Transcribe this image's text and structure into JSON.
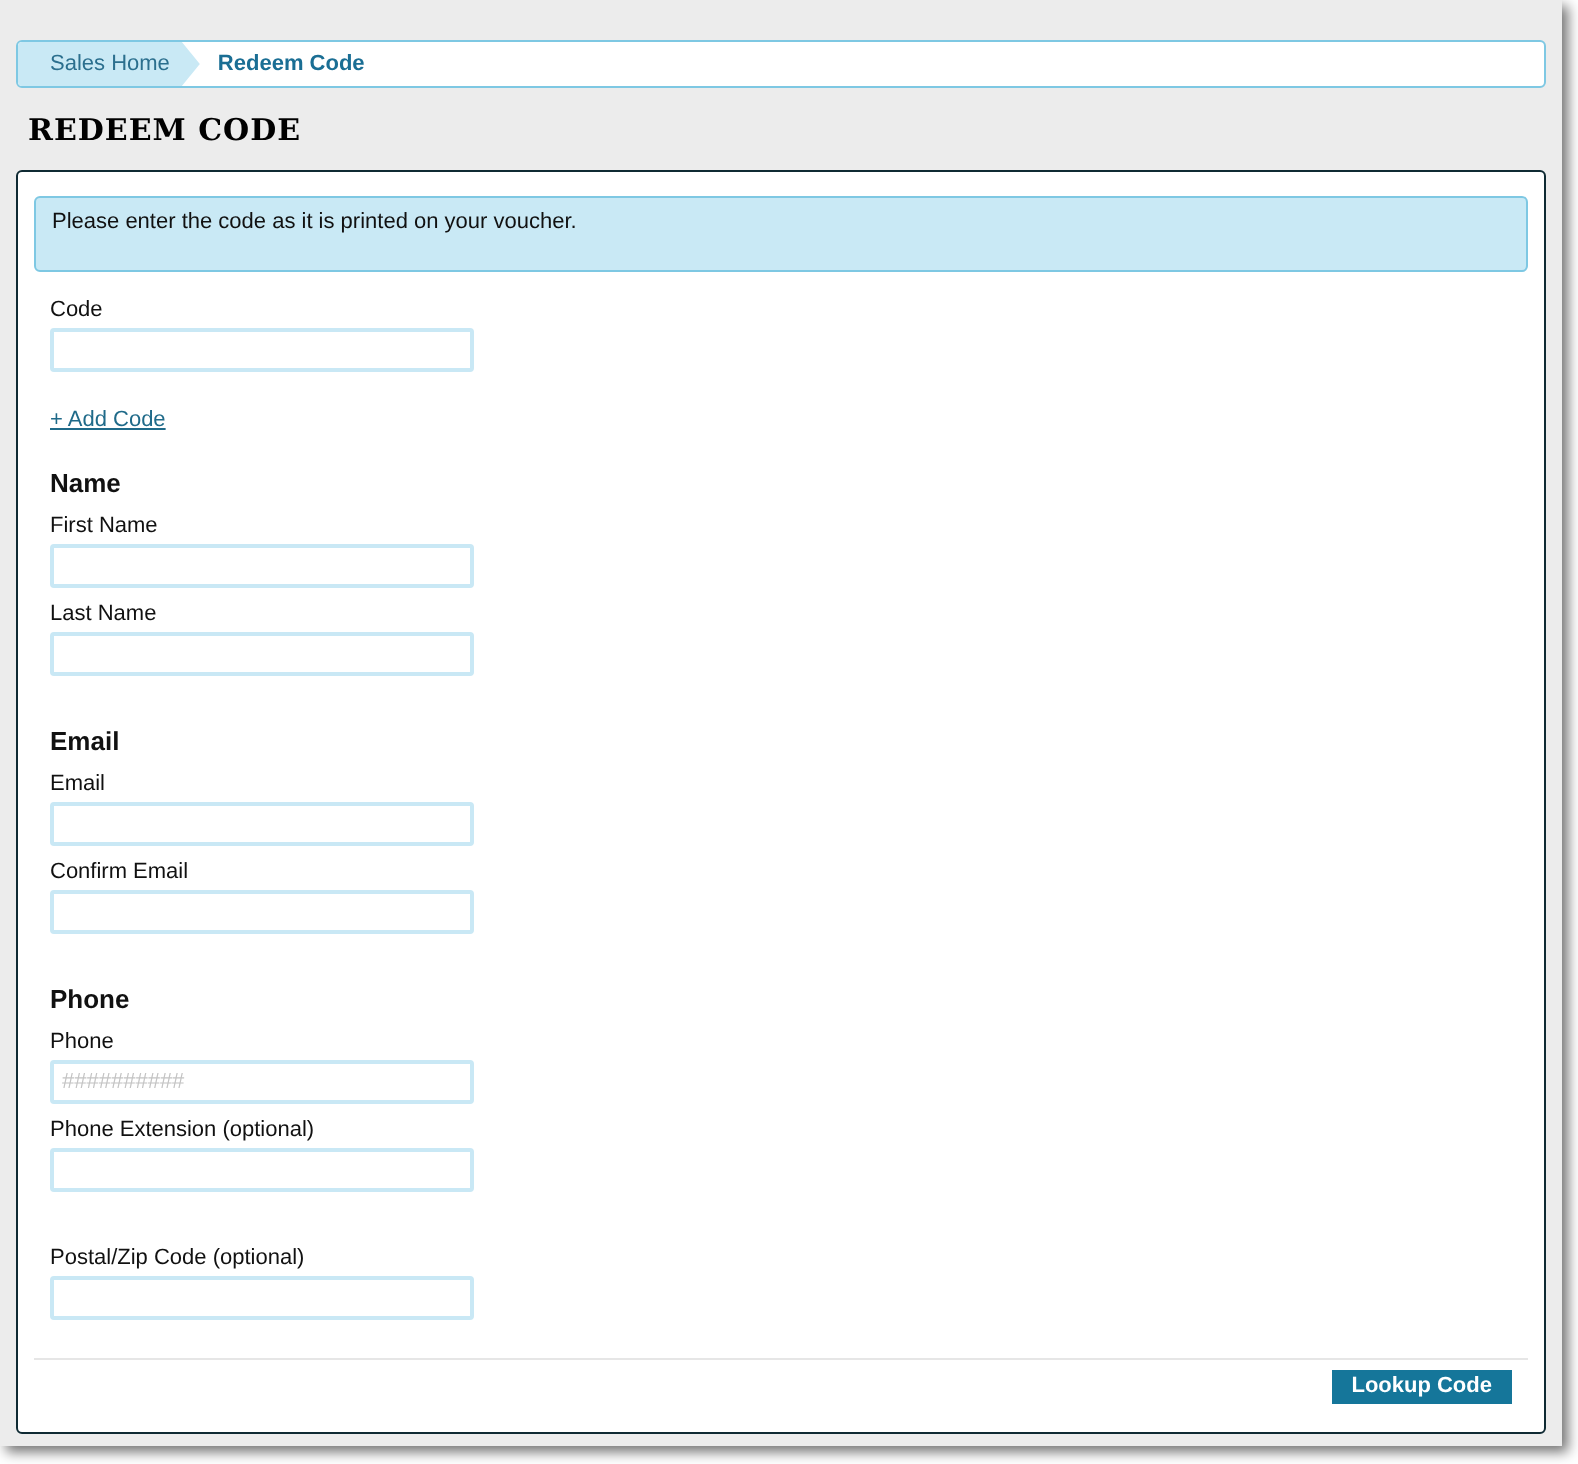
{
  "breadcrumb": [
    {
      "label": "Sales Home",
      "selected": false
    },
    {
      "label": "Redeem Code",
      "selected": true
    }
  ],
  "page_title": "REDEEM CODE",
  "notice": "Please enter the code as it is printed on your voucher.",
  "sections": [
    {
      "fields": [
        {
          "label": "Code"
        }
      ],
      "link": "+ Add Code"
    },
    {
      "heading": "Name",
      "fields": [
        {
          "label": "First Name"
        },
        {
          "label": "Last Name"
        }
      ]
    },
    {
      "heading": "Email",
      "fields": [
        {
          "label": "Email"
        },
        {
          "label": "Confirm Email"
        }
      ]
    },
    {
      "heading": "Phone",
      "fields": [
        {
          "label": "Phone",
          "placeholder": "##########"
        },
        {
          "label": "Phone Extension (optional)"
        }
      ]
    },
    {
      "fields": [
        {
          "label": "Postal/Zip Code (optional)"
        }
      ]
    }
  ],
  "submit_button": "Lookup Code"
}
